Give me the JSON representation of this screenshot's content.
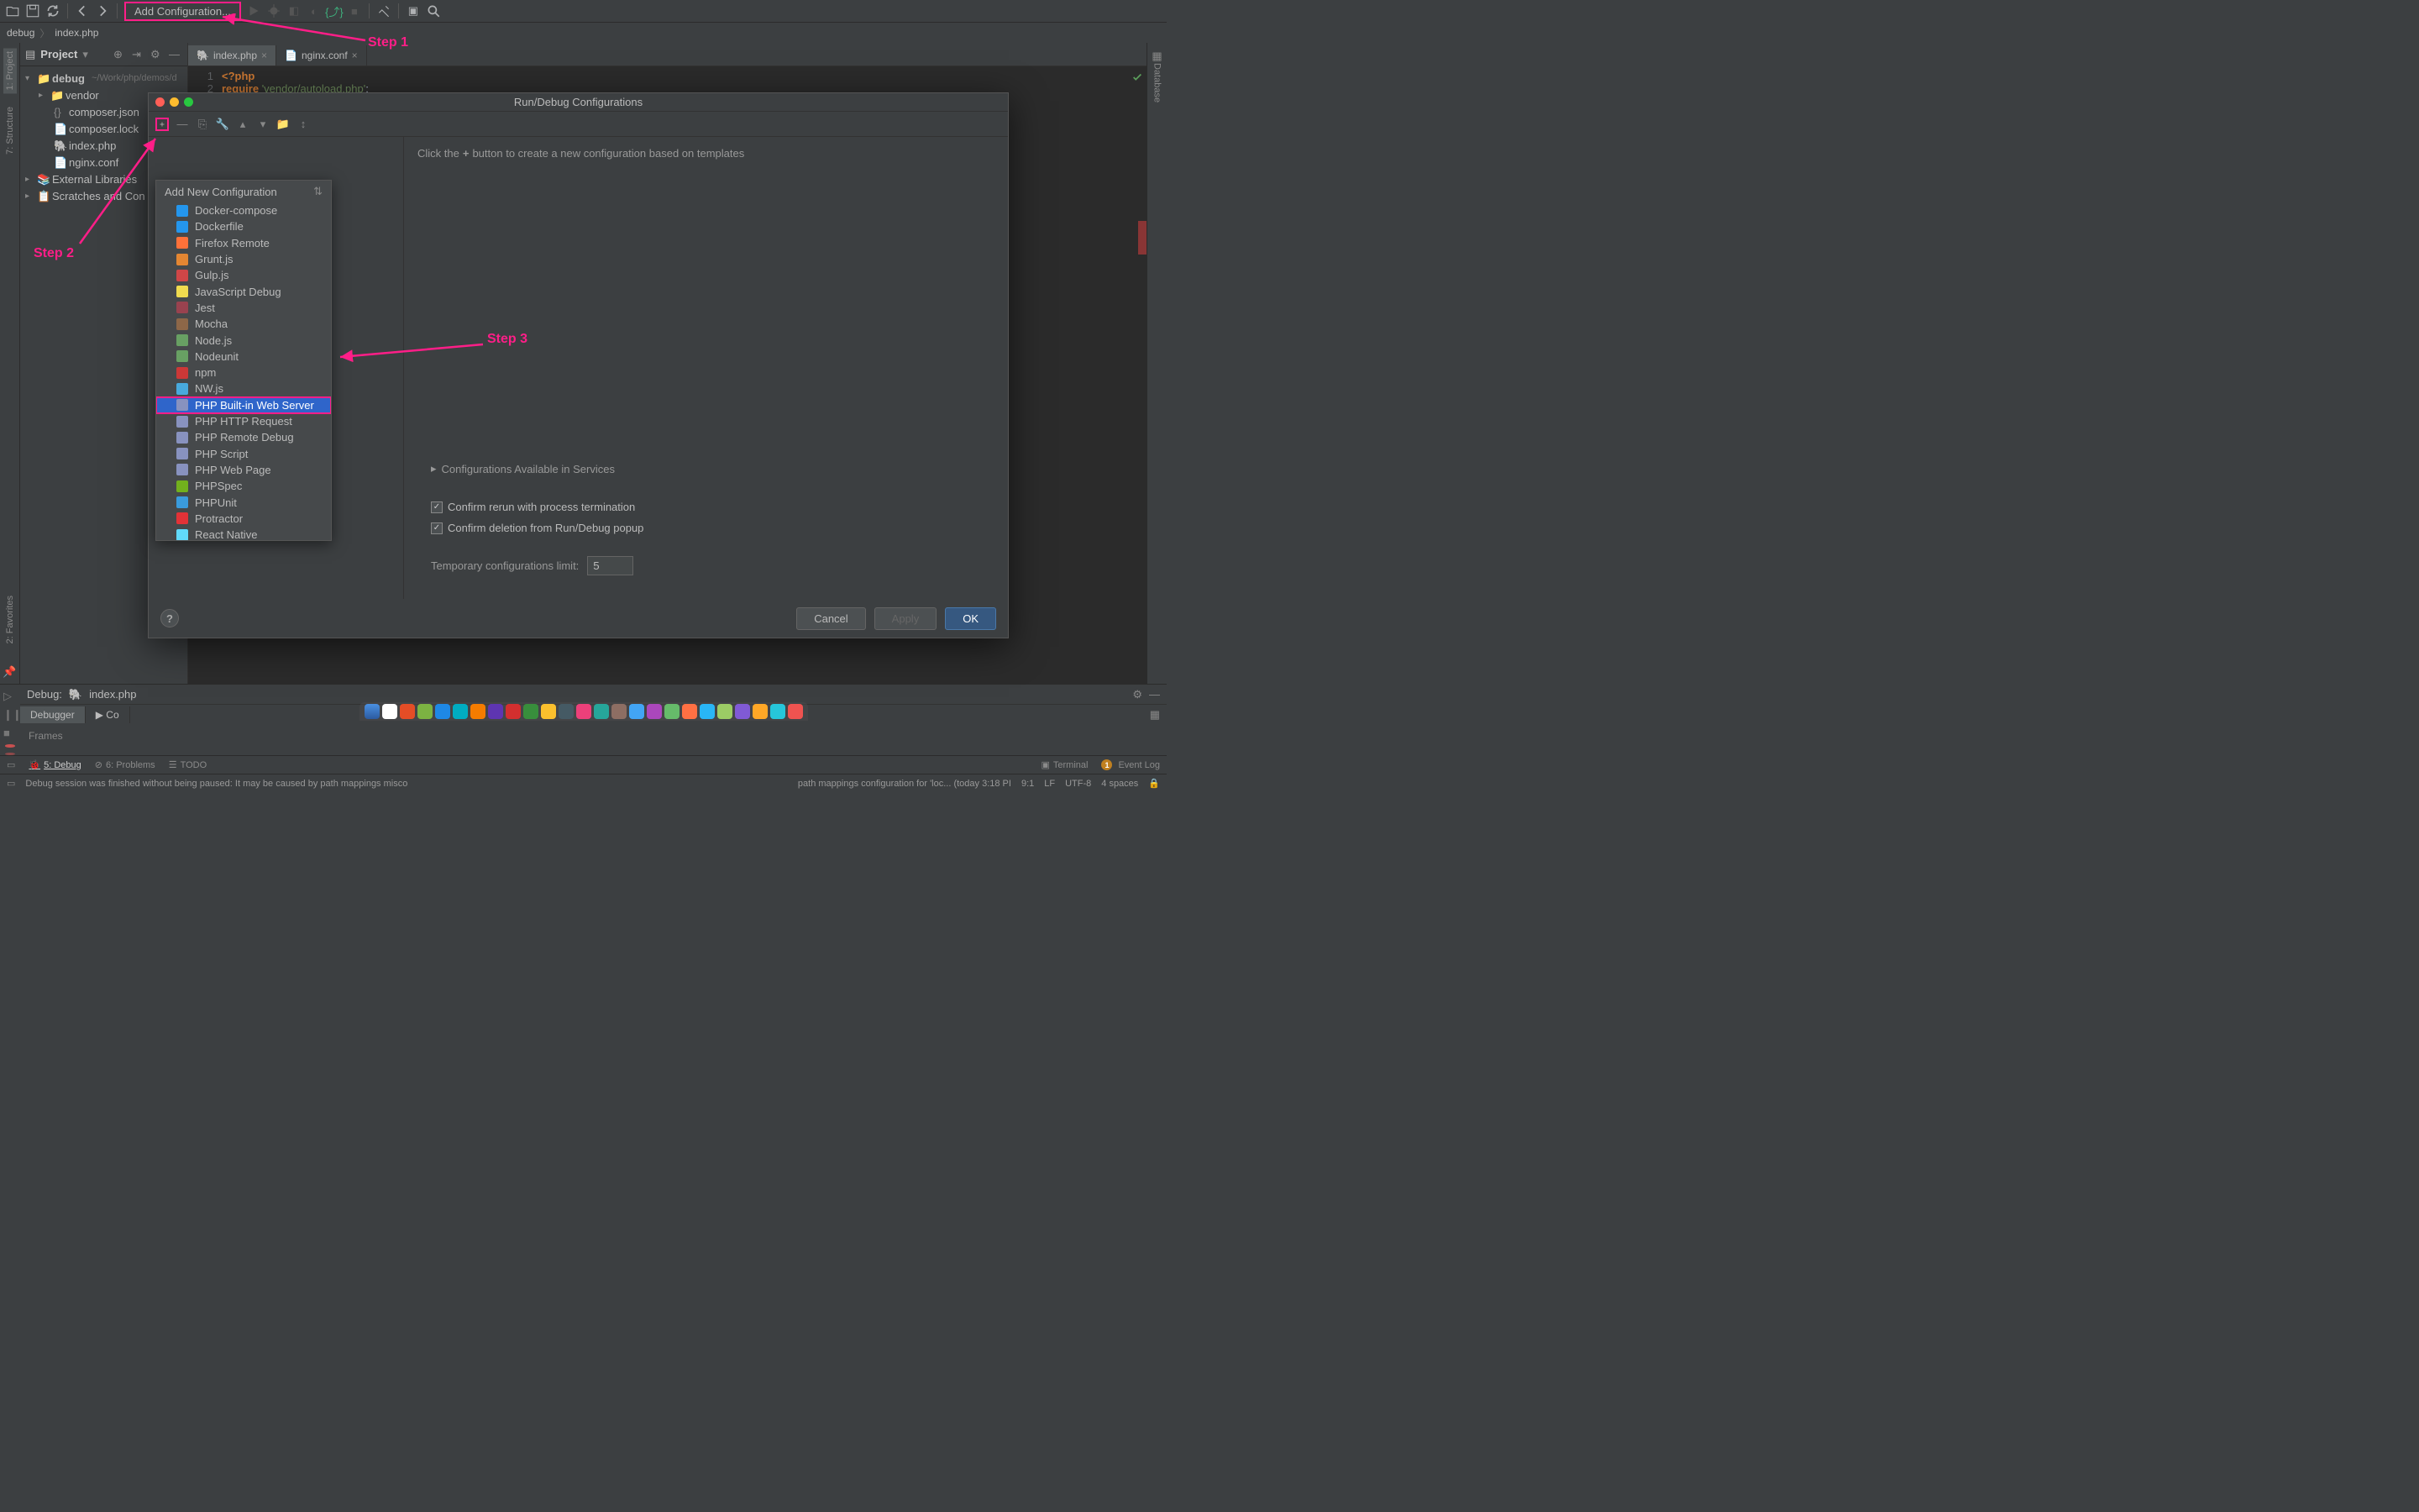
{
  "toolbar": {
    "config_label": "Add Configuration..."
  },
  "breadcrumb": {
    "project": "debug",
    "file": "index.php"
  },
  "project_panel": {
    "title": "Project",
    "root": {
      "name": "debug",
      "path": "~/Work/php/demos/d"
    },
    "items": [
      {
        "name": "vendor",
        "type": "folder",
        "indent": 1,
        "expandable": true
      },
      {
        "name": "composer.json",
        "type": "json",
        "indent": 1
      },
      {
        "name": "composer.lock",
        "type": "txt",
        "indent": 1
      },
      {
        "name": "index.php",
        "type": "php",
        "indent": 1
      },
      {
        "name": "nginx.conf",
        "type": "txt",
        "indent": 1
      }
    ],
    "external_libs": "External Libraries",
    "scratches": "Scratches and Con"
  },
  "editor": {
    "tabs": [
      {
        "label": "index.php",
        "active": true
      },
      {
        "label": "nginx.conf",
        "active": false
      }
    ],
    "lines": [
      {
        "n": "1",
        "html": "<span class='kw'>&lt;?php</span>"
      },
      {
        "n": "2",
        "html": "<span class='kw'>require</span> <span class='str'>'vendor/autoload.php'</span>;"
      }
    ]
  },
  "sidebar_left": [
    {
      "label": "1: Project",
      "sel": true
    },
    {
      "label": "7: Structure",
      "sel": false
    },
    {
      "label": "2: Favorites",
      "sel": false
    }
  ],
  "sidebar_right": [
    {
      "label": "Database"
    }
  ],
  "debug_panel": {
    "title": "Debug:",
    "target": "index.php",
    "tabs": [
      "Debugger",
      "Co"
    ],
    "frames": "Frames"
  },
  "toolwindows": {
    "left": [
      {
        "label": "5: Debug",
        "sel": true
      },
      {
        "label": "6: Problems",
        "sel": false
      },
      {
        "label": "TODO",
        "sel": false
      }
    ],
    "right": [
      {
        "label": "Terminal"
      },
      {
        "label": "Event Log",
        "badge": "1"
      }
    ]
  },
  "status": {
    "msg_left": "Debug session was finished without being paused: It may be caused by path mappings misco",
    "msg_mid": "path mappings configuration for 'loc... (today 3:18 PI",
    "pos": "9:1",
    "sep": "LF",
    "enc": "UTF-8",
    "indent": "4 spaces"
  },
  "dialog": {
    "title": "Run/Debug Configurations",
    "hint_prefix": "Click the",
    "hint_suffix": "button to create a new configuration based on templates",
    "collapsible": "Configurations Available in Services",
    "cb1": "Confirm rerun with process termination",
    "cb2": "Confirm deletion from Run/Debug popup",
    "limit_label": "Temporary configurations limit:",
    "limit_value": "5",
    "cancel": "Cancel",
    "apply": "Apply",
    "ok": "OK"
  },
  "dropdown": {
    "header": "Add New Configuration",
    "items": [
      "Docker-compose",
      "Dockerfile",
      "Firefox Remote",
      "Grunt.js",
      "Gulp.js",
      "JavaScript Debug",
      "Jest",
      "Mocha",
      "Node.js",
      "Nodeunit",
      "npm",
      "NW.js",
      "PHP Built-in Web Server",
      "PHP HTTP Request",
      "PHP Remote Debug",
      "PHP Script",
      "PHP Web Page",
      "PHPSpec",
      "PHPUnit",
      "Protractor",
      "React Native"
    ],
    "selected_index": 12
  },
  "annotations": {
    "step1": "Step 1",
    "step2": "Step 2",
    "step3": "Step 3"
  }
}
